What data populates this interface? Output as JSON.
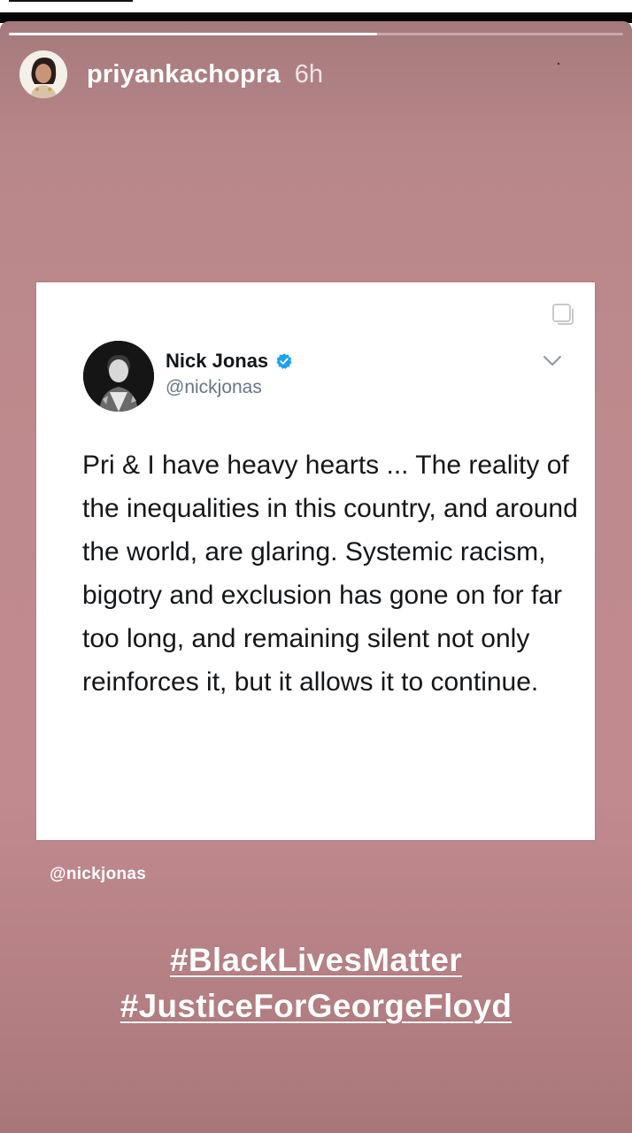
{
  "story": {
    "username": "priyankachopra",
    "time": "6h",
    "progress": 0.6,
    "background_color": "#bf8a8d"
  },
  "tweet": {
    "name": "Nick Jonas",
    "handle": "@nickjonas",
    "verified": true,
    "text": "Pri & I have heavy hearts ... The reality of the inequalities in this country, and around the world, are glaring. Systemic racism, bigotry and exclusion has gone on for far too long, and remaining silent not only reinforces it, but it allows it to continue."
  },
  "sticker": {
    "mention": "@nickjonas",
    "hashtags": [
      "#BlackLivesMatter",
      "#JusticeForGeorgeFloyd"
    ]
  },
  "icons": {
    "copy": "copy-icon",
    "verified": "verified-badge-icon",
    "chevron": "chevron-down-icon"
  }
}
